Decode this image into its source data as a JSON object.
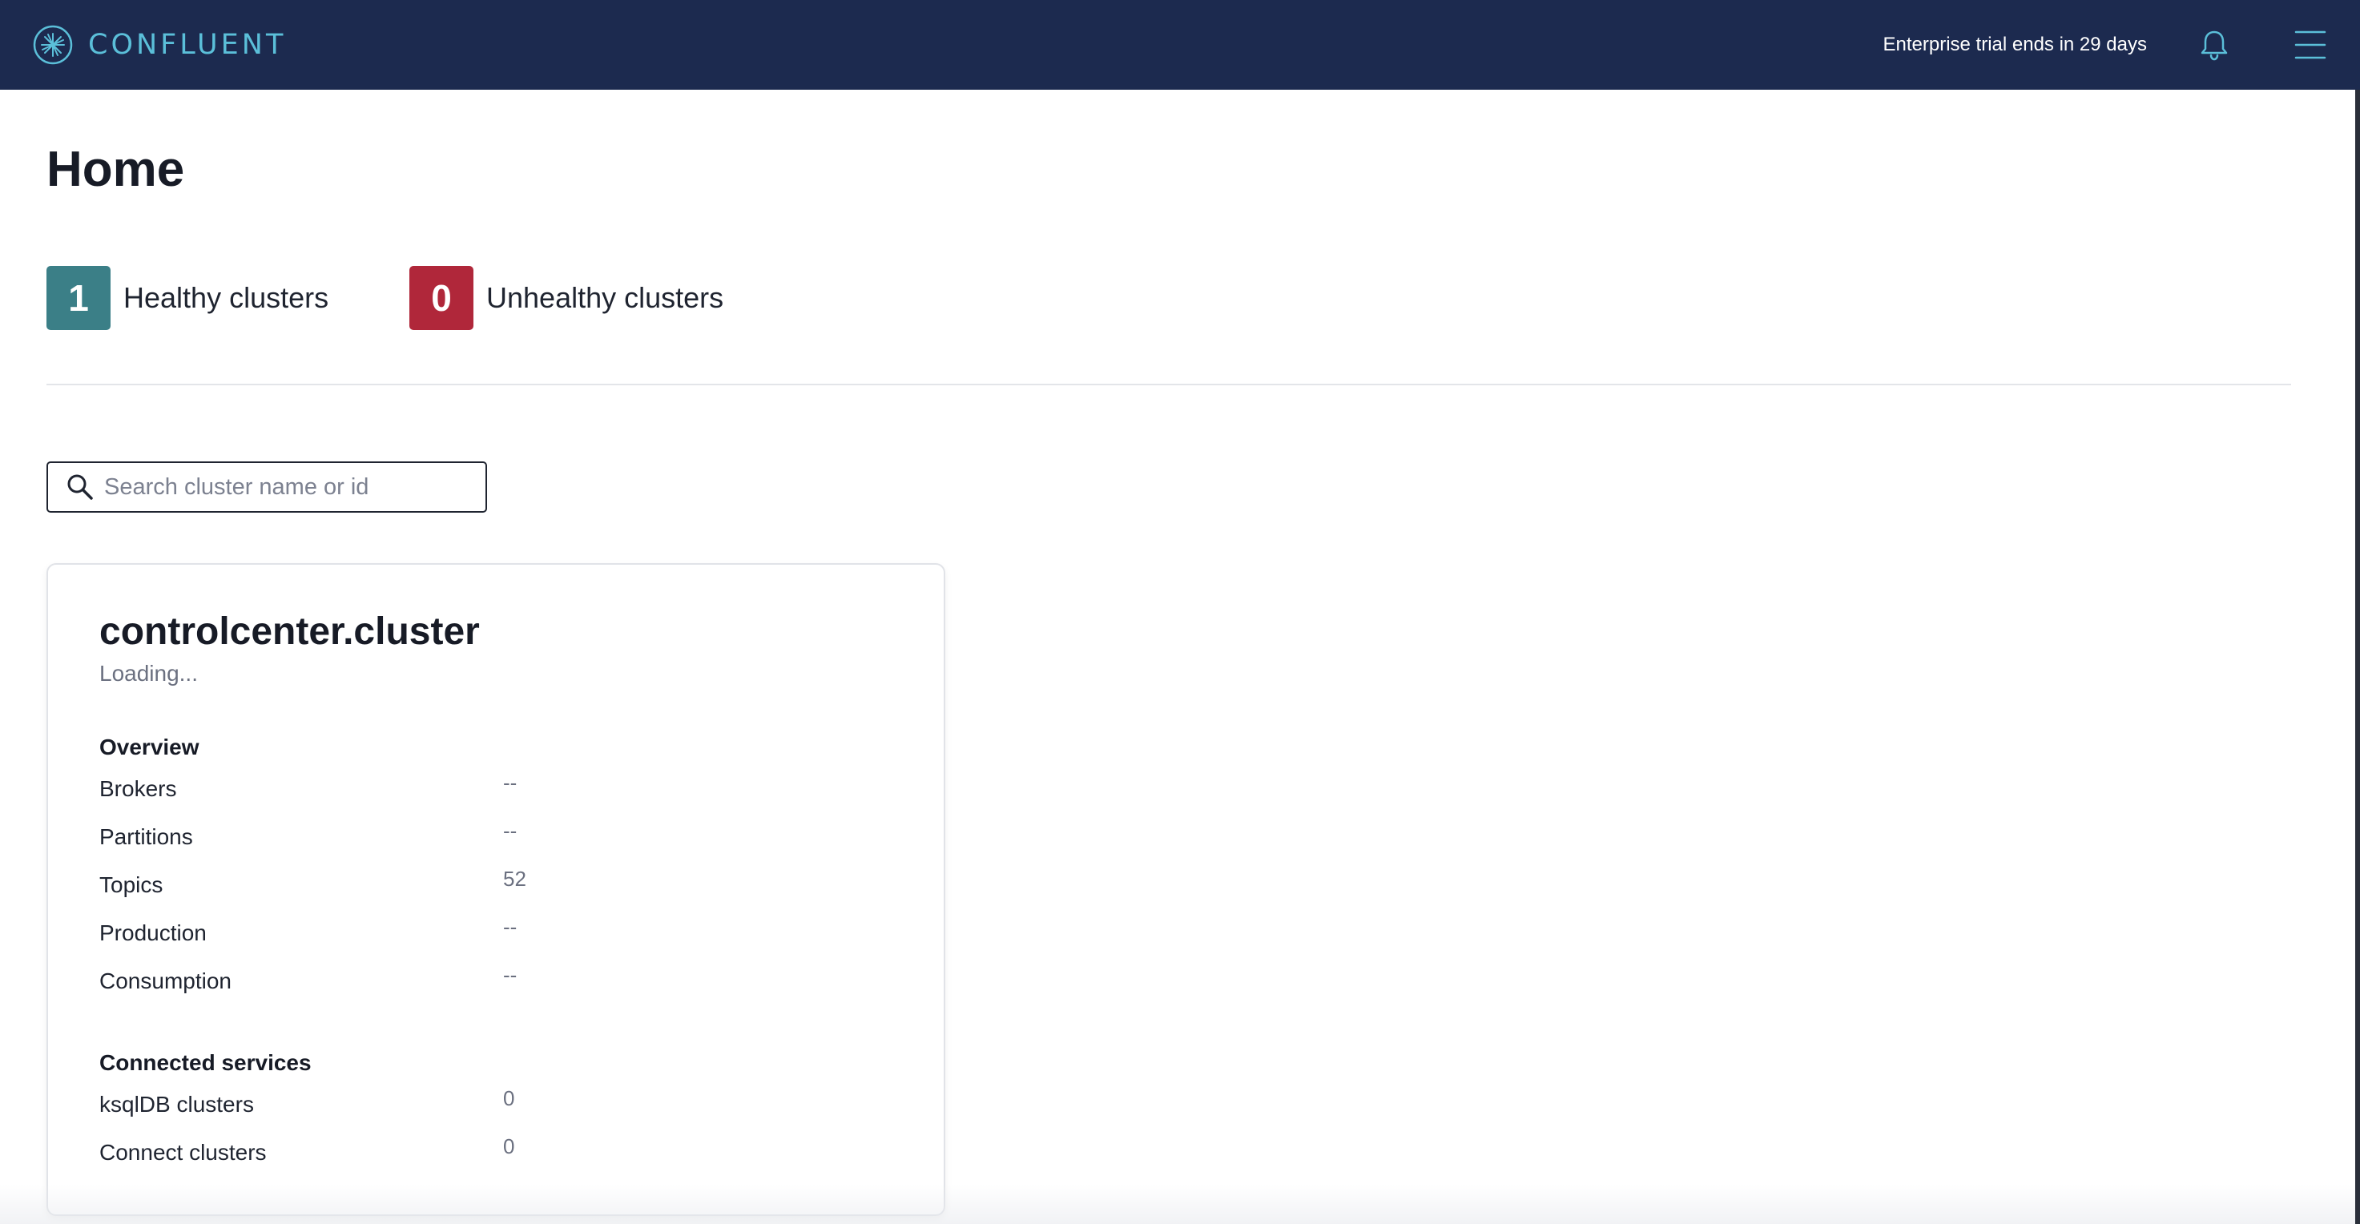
{
  "header": {
    "brand": "CONFLUENT",
    "trial_notice": "Enterprise trial ends in 29 days",
    "background_color": "#1c2a4f",
    "brand_color": "#5bbfd9",
    "icons": [
      "confluent-logo-icon",
      "bell-icon",
      "menu-icon"
    ]
  },
  "main": {
    "title": "Home",
    "stats": {
      "healthy": {
        "count": "1",
        "label": "Healthy clusters",
        "color": "#3b7f87"
      },
      "unhealthy": {
        "count": "0",
        "label": "Unhealthy clusters",
        "color": "#b0273a"
      }
    },
    "search": {
      "placeholder": "Search cluster name or id",
      "value": "",
      "icon": "search-icon"
    },
    "cluster_card": {
      "name": "controlcenter.cluster",
      "status": "Loading...",
      "overview": {
        "heading": "Overview",
        "rows": [
          {
            "label": "Brokers",
            "value": "--"
          },
          {
            "label": "Partitions",
            "value": "--"
          },
          {
            "label": "Topics",
            "value": "52"
          },
          {
            "label": "Production",
            "value": "--"
          },
          {
            "label": "Consumption",
            "value": "--"
          }
        ]
      },
      "connected_services": {
        "heading": "Connected services",
        "rows": [
          {
            "label": "ksqlDB clusters",
            "value": "0"
          },
          {
            "label": "Connect clusters",
            "value": "0"
          }
        ]
      }
    }
  }
}
